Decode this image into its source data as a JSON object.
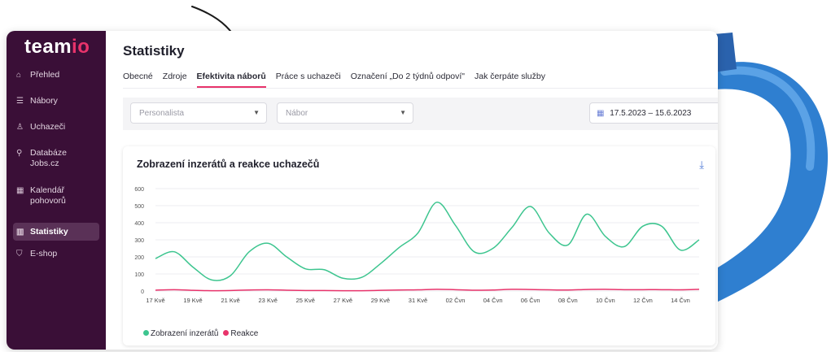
{
  "brand": {
    "name_main": "team",
    "name_accent": "io"
  },
  "sidebar": {
    "items": [
      {
        "icon": "home-icon",
        "glyph": "⌂",
        "label": "Přehled"
      },
      {
        "icon": "list-icon",
        "glyph": "☰",
        "label": "Nábory"
      },
      {
        "icon": "person-icon",
        "glyph": "♙",
        "label": "Uchazeči"
      },
      {
        "icon": "database-icon",
        "glyph": "⚲",
        "label": "Databáze Jobs.cz"
      },
      {
        "icon": "calendar-icon",
        "glyph": "▦",
        "label": "Kalendář pohovorů"
      },
      {
        "icon": "chart-icon",
        "glyph": "▥",
        "label": "Statistiky"
      },
      {
        "icon": "cart-icon",
        "glyph": "⛉",
        "label": "E-shop"
      }
    ]
  },
  "header": {
    "title": "Statistiky"
  },
  "tabs": [
    "Obecné",
    "Zdroje",
    "Efektivita náborů",
    "Práce s uchazeči",
    "Označení „Do 2 týdnů odpoví\"",
    "Jak čerpáte služby"
  ],
  "active_tab": "Efektivita náborů",
  "filters": {
    "recruiter_placeholder": "Personalista",
    "recruitment_placeholder": "Nábor",
    "date_range": "17.5.2023 – 15.6.2023"
  },
  "card": {
    "title": "Zobrazení inzerátů a reakce uchazečů"
  },
  "colors": {
    "accent": "#e8336b",
    "series_views": "#3dc58f",
    "series_reactions": "#e8336b",
    "sidebar": "#3a0f37"
  },
  "chart_data": {
    "type": "line",
    "x": [
      "17 Kvě",
      "18 Kvě",
      "19 Kvě",
      "20 Kvě",
      "21 Kvě",
      "22 Kvě",
      "23 Kvě",
      "24 Kvě",
      "25 Kvě",
      "26 Kvě",
      "27 Kvě",
      "28 Kvě",
      "29 Kvě",
      "30 Kvě",
      "31 Kvě",
      "01 Čvn",
      "02 Čvn",
      "03 Čvn",
      "04 Čvn",
      "05 Čvn",
      "06 Čvn",
      "07 Čvn",
      "08 Čvn",
      "09 Čvn",
      "10 Čvn",
      "11 Čvn",
      "12 Čvn",
      "13 Čvn",
      "14 Čvn",
      "15 Čvn"
    ],
    "tick_labels": [
      "17 Kvě",
      "19 Kvě",
      "21 Kvě",
      "23 Kvě",
      "25 Kvě",
      "27 Kvě",
      "29 Kvě",
      "31 Kvě",
      "02 Čvn",
      "04 Čvn",
      "06 Čvn",
      "08 Čvn",
      "10 Čvn",
      "12 Čvn",
      "14 Čvn"
    ],
    "series": [
      {
        "name": "Zobrazení inzerátů",
        "values": [
          190,
          230,
          140,
          65,
          90,
          230,
          280,
          200,
          130,
          125,
          75,
          80,
          160,
          255,
          340,
          520,
          385,
          230,
          250,
          370,
          495,
          340,
          270,
          450,
          320,
          260,
          380,
          380,
          240,
          300
        ]
      },
      {
        "name": "Reakce",
        "values": [
          5,
          8,
          4,
          2,
          3,
          6,
          7,
          5,
          3,
          3,
          2,
          2,
          4,
          6,
          7,
          10,
          8,
          5,
          6,
          10,
          9,
          7,
          6,
          9,
          10,
          8,
          8,
          8,
          7,
          10
        ]
      }
    ],
    "yticks": [
      0,
      100,
      200,
      300,
      400,
      500,
      600
    ],
    "ylim": [
      0,
      600
    ],
    "legend": "bottom-left",
    "grid": true
  }
}
